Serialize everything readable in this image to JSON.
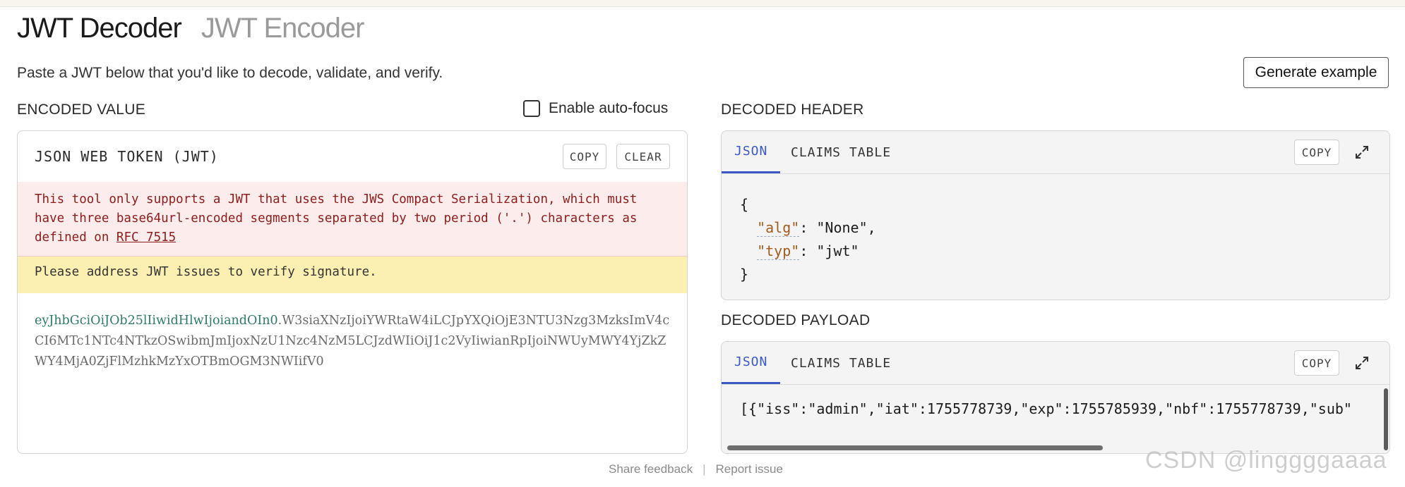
{
  "tabs": {
    "decoder": "JWT Decoder",
    "encoder": "JWT Encoder"
  },
  "subtitle": "Paste a JWT below that you'd like to decode, validate, and verify.",
  "generate_button": "Generate example",
  "encoded": {
    "section_label": "ENCODED VALUE",
    "autofocus_label": "Enable auto-focus",
    "panel_title": "JSON WEB TOKEN (JWT)",
    "copy_label": "COPY",
    "clear_label": "CLEAR",
    "error_text": "This tool only supports a JWT that uses the JWS Compact Serialization, which must have three base64url-encoded segments separated by two period ('.') characters as defined on ",
    "error_link": "RFC 7515",
    "warning_text": "Please address JWT issues to verify signature.",
    "token_header": "eyJhbGciOiJOb25lIiwidHlwIjoiandOIn0",
    "token_rest": ".W3siaXNzIjoiYWRtaW4iLCJpYXQiOjE3NTU3Nzg3MzksImV4cCI6MTc1NTc4NTkzOSwibmJmIjoxNzU1Nzc4NzM5LCJzdWIiOiJ1c2VyIiwianRpIjoiNWUyMWY4YjZkZWY4MjA0ZjFlMzhkMzYxOTBmOGM3NWIifV0"
  },
  "header": {
    "section_label": "DECODED HEADER",
    "tab_json": "JSON",
    "tab_claims": "CLAIMS TABLE",
    "copy_label": "COPY",
    "open_brace": "{",
    "close_brace": "}",
    "alg_key": "\"alg\"",
    "alg_value": ": \"None\",",
    "typ_key": "\"typ\"",
    "typ_value": ": \"jwt\""
  },
  "payload": {
    "section_label": "DECODED PAYLOAD",
    "tab_json": "JSON",
    "tab_claims": "CLAIMS TABLE",
    "copy_label": "COPY",
    "content": "[{\"iss\":\"admin\",\"iat\":1755778739,\"exp\":1755785939,\"nbf\":1755778739,\"sub\""
  },
  "footer": {
    "feedback": "Share feedback",
    "separator": "|",
    "report": "Report issue"
  },
  "watermark": "CSDN @linggggaaaa",
  "colors": {
    "accent": "#3a58c4",
    "error_bg": "#fdecec",
    "warning_bg": "#fbf0b2",
    "key": "#a25b1d",
    "token_header": "#2e7a6a"
  },
  "icons": [
    "expand-icon",
    "checkbox-icon"
  ]
}
